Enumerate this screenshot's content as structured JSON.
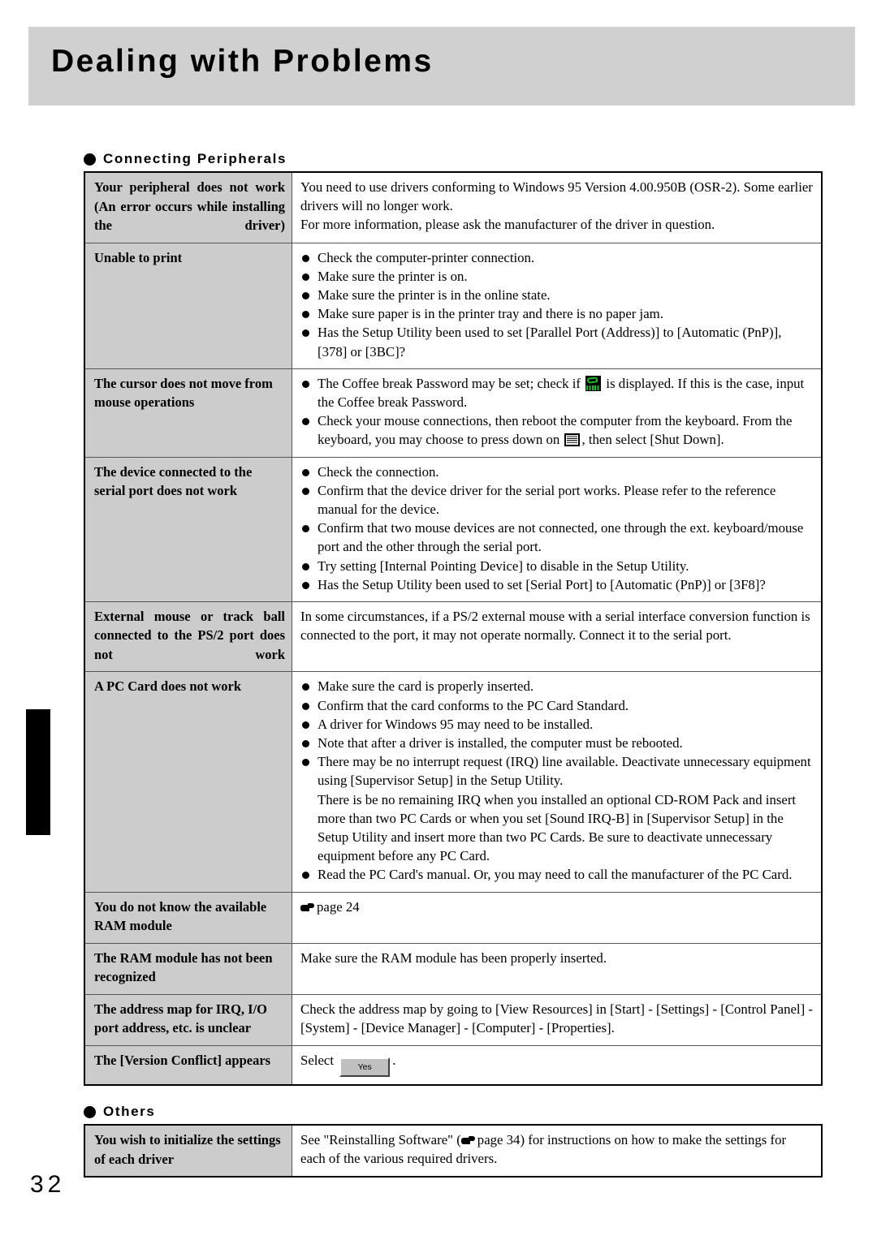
{
  "page": {
    "title": "Dealing with Problems",
    "number": "32"
  },
  "sections": [
    {
      "heading": "Connecting Peripherals",
      "rows": [
        {
          "symptom": "Your peripheral does not work (An error occurs while installing the driver)",
          "symptom_justified": true,
          "solution_type": "paragraphs",
          "paragraphs": [
            "You need to use drivers conforming to Windows 95 Version 4.00.950B (OSR-2).  Some earlier drivers will no longer work.",
            "For more information, please ask the manufacturer of the driver in question."
          ]
        },
        {
          "symptom": "Unable to print",
          "symptom_justified": false,
          "solution_type": "bullets",
          "bullets": [
            "Check the computer-printer connection.",
            "Make sure the printer is on.",
            "Make sure the printer is in the online state.",
            "Make sure paper is in the printer tray and there is no paper jam.",
            "Has the Setup Utility been used to set [Parallel Port (Address)] to [Automatic (PnP)], [378] or [3BC]?"
          ]
        },
        {
          "symptom": "The cursor does not move from mouse operations",
          "symptom_justified": false,
          "solution_type": "bullets-icons",
          "bullets_rich": [
            {
              "parts": [
                {
                  "t": "text",
                  "v": "The Coffee break Password may be set; check if "
                },
                {
                  "t": "icon",
                  "v": "coffee-break-icon"
                },
                {
                  "t": "text",
                  "v": " is displayed. If this is the case, input the Coffee break Password."
                }
              ]
            },
            {
              "parts": [
                {
                  "t": "text",
                  "v": "Check your mouse connections, then reboot the computer from the keyboard. From the keyboard, you may choose to press down on "
                },
                {
                  "t": "icon",
                  "v": "keyboard-icon"
                },
                {
                  "t": "text",
                  "v": ", then select [Shut Down]."
                }
              ]
            }
          ]
        },
        {
          "symptom": "The device connected to the serial port does not work",
          "symptom_justified": false,
          "solution_type": "bullets",
          "bullets": [
            "Check the connection.",
            "Confirm that the device driver for the serial port works.  Please refer to the reference manual for the device.",
            "Confirm that two mouse devices are not connected, one through the ext. keyboard/mouse port and the other through the serial port.",
            "Try setting [Internal Pointing Device] to disable in the Setup Utility.",
            "Has the Setup Utility been used to set [Serial Port] to [Automatic (PnP)] or [3F8]?"
          ]
        },
        {
          "symptom": "External mouse or track ball connected to the PS/2 port does not work",
          "symptom_justified": true,
          "solution_type": "paragraphs",
          "paragraphs": [
            "In some circumstances, if a PS/2 external mouse with a serial interface conversion function is connected to the port, it may not operate normally. Connect it to the serial port."
          ]
        },
        {
          "symptom": "A PC Card does not work",
          "symptom_justified": false,
          "solution_type": "bullets-multi",
          "bullets_multi": [
            [
              "Make sure the card is properly inserted."
            ],
            [
              "Confirm that the card conforms to the PC Card Standard."
            ],
            [
              "A driver for Windows 95 may need to be installed."
            ],
            [
              "Note that after a driver is installed, the computer must be rebooted."
            ],
            [
              "There may be no interrupt request (IRQ) line available. Deactivate unnecessary equipment using [Supervisor Setup] in the Setup Utility.",
              "There is be no remaining IRQ when you installed an optional CD-ROM Pack and insert more than two PC Cards or when you set [Sound IRQ-B] in [Supervisor Setup] in the Setup Utility and insert more than two PC Cards. Be sure to deactivate unnecessary equipment before any PC Card."
            ],
            [
              "Read the PC Card's manual.  Or, you may need to call the manufacturer of the PC Card."
            ]
          ]
        },
        {
          "symptom": "You do not know the available RAM module",
          "symptom_justified": false,
          "solution_type": "page-ref",
          "page_ref_label": "page 24"
        },
        {
          "symptom": "The RAM module has not been recognized",
          "symptom_justified": false,
          "solution_type": "paragraphs",
          "paragraphs": [
            "Make sure the RAM module has been properly inserted."
          ]
        },
        {
          "symptom": "The address map for IRQ, I/O port address, etc. is unclear",
          "symptom_justified": false,
          "solution_type": "paragraphs",
          "paragraphs": [
            "Check the address map by going to [View Resources] in [Start] - [Settings] - [Control Panel] - [System] - [Device Manager] - [Computer] - [Properties]."
          ]
        },
        {
          "symptom": "The [Version Conflict] appears",
          "symptom_justified": false,
          "solution_type": "select-button",
          "select_prefix": "Select",
          "button_label": "Yes",
          "select_suffix": "."
        }
      ]
    },
    {
      "heading": "Others",
      "rows": [
        {
          "symptom": "You wish to initialize the settings of each driver",
          "symptom_justified": false,
          "solution_type": "page-ref-inline",
          "inline_prefix": "See \"Reinstalling Software\" (",
          "page_ref_label": "page 34",
          "inline_suffix": ") for instructions on how to make the settings for each of the various required drivers."
        }
      ]
    }
  ]
}
